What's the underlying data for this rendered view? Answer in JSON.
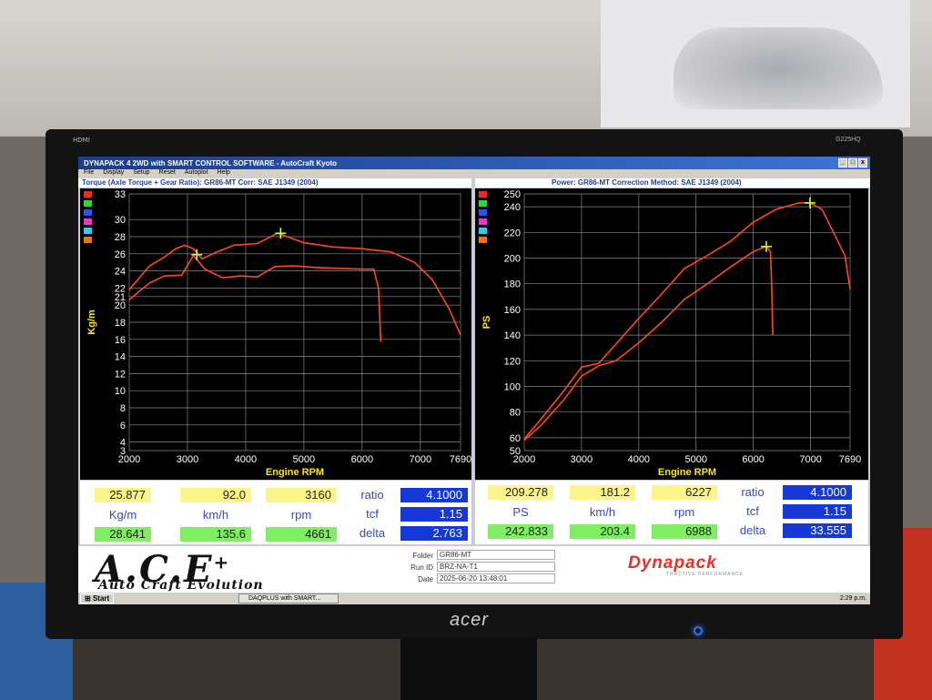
{
  "monitor": {
    "input_label": "HDMI",
    "model": "G225HQ",
    "brand": "acer"
  },
  "window": {
    "title": "DYNAPACK 4 2WD with SMART CONTROL SOFTWARE - AutoCraft Kyoto",
    "buttons": [
      "_",
      "□",
      "x"
    ],
    "menu": [
      "File",
      "Display",
      "Setup",
      "Reset",
      "Autoplot",
      "Help"
    ]
  },
  "headers": {
    "left": "Torque (Axle Torque + Gear Ratio): GR86-MT      Corr: SAE J1349 (2004)",
    "right": "Power: GR86-MT        Correction Method: SAE J1349 (2004)"
  },
  "colors": {
    "curve": "#ff4a1a",
    "marker": "#c8ff30",
    "grid": "#8a8a8a",
    "axis_label": "#ffe600",
    "legend": [
      "#e0302a",
      "#3ad23a",
      "#2a54e0",
      "#e040c0",
      "#36c8e8",
      "#e8742a"
    ]
  },
  "chart_data": [
    {
      "type": "line",
      "xlabel": "Engine RPM",
      "ylabel": "Kg/m",
      "xlim": [
        2000,
        7690
      ],
      "ylim": [
        3,
        33
      ],
      "x_ticks": [
        "2000",
        "3000",
        "4000",
        "5000",
        "6000",
        "7000",
        "7690"
      ],
      "y_ticks": [
        "3",
        "4",
        "6",
        "8",
        "10",
        "12",
        "14",
        "16",
        "18",
        "20",
        "21",
        "22",
        "24",
        "26",
        "28",
        "30",
        "33"
      ],
      "series": [
        {
          "x": [
            2000,
            2150,
            2350,
            2600,
            2800,
            2950,
            3100,
            3250,
            3500,
            3800,
            4200,
            4550,
            4750,
            5000,
            5500,
            6000,
            6500,
            6900,
            7200,
            7500,
            7690
          ],
          "y": [
            21.8,
            23.0,
            24.6,
            25.6,
            26.6,
            27.0,
            26.6,
            25.4,
            26.2,
            27.0,
            27.2,
            28.4,
            27.9,
            27.3,
            26.8,
            26.6,
            26.2,
            25.0,
            23.0,
            19.5,
            16.5
          ]
        },
        {
          "x": [
            2000,
            2150,
            2350,
            2600,
            2900,
            3100,
            3300,
            3600,
            3900,
            4200,
            4500,
            4800,
            5200,
            5600,
            6000,
            6200,
            6280,
            6300,
            6320
          ],
          "y": [
            20.6,
            21.5,
            22.6,
            23.4,
            23.5,
            25.8,
            24.2,
            23.2,
            23.4,
            23.3,
            24.5,
            24.6,
            24.4,
            24.3,
            24.2,
            24.2,
            22.0,
            19.0,
            15.7
          ]
        }
      ],
      "markers": [
        {
          "x": 4600,
          "y": 28.4
        },
        {
          "x": 3160,
          "y": 25.9
        }
      ]
    },
    {
      "type": "line",
      "xlabel": "Engine RPM",
      "ylabel": "PS",
      "xlim": [
        2000,
        7690
      ],
      "ylim": [
        50,
        250
      ],
      "x_ticks": [
        "2000",
        "3000",
        "4000",
        "5000",
        "6000",
        "7000",
        "7690"
      ],
      "y_ticks": [
        "50",
        "60",
        "80",
        "100",
        "120",
        "140",
        "160",
        "180",
        "200",
        "220",
        "240",
        "250"
      ],
      "series": [
        {
          "x": [
            2000,
            2300,
            2700,
            3000,
            3300,
            3600,
            4000,
            4400,
            4800,
            5200,
            5600,
            6000,
            6400,
            6800,
            6990,
            7200,
            7400,
            7600,
            7690
          ],
          "y": [
            59,
            75,
            97,
            115,
            118,
            133,
            153,
            172,
            192,
            202,
            213,
            228,
            238,
            243,
            243,
            238,
            220,
            202,
            176
          ]
        },
        {
          "x": [
            2000,
            2300,
            2700,
            3000,
            3300,
            3600,
            4000,
            4400,
            4800,
            5200,
            5600,
            6000,
            6227,
            6300,
            6320,
            6340
          ],
          "y": [
            58,
            70,
            90,
            108,
            116,
            120,
            134,
            150,
            168,
            180,
            193,
            205,
            209,
            205,
            180,
            140
          ]
        }
      ],
      "markers": [
        {
          "x": 6990,
          "y": 243
        },
        {
          "x": 6227,
          "y": 209
        }
      ]
    }
  ],
  "left_panel": {
    "row1": [
      "25.877",
      "92.0",
      "3160"
    ],
    "units": [
      "Kg/m",
      "km/h",
      "rpm"
    ],
    "row2": [
      "28.641",
      "135.6",
      "4661"
    ],
    "params": [
      {
        "label": "ratio",
        "value": "4.1000"
      },
      {
        "label": "tcf",
        "value": "1.15"
      },
      {
        "label": "delta",
        "value": "2.763"
      }
    ]
  },
  "right_panel": {
    "row1": [
      "209.278",
      "181.2",
      "6227"
    ],
    "units": [
      "PS",
      "km/h",
      "rpm"
    ],
    "row2": [
      "242.833",
      "203.4",
      "6988"
    ],
    "params": [
      {
        "label": "ratio",
        "value": "4.1000"
      },
      {
        "label": "tcf",
        "value": "1.15"
      },
      {
        "label": "delta",
        "value": "33.555"
      }
    ]
  },
  "footer": {
    "logo": "A.C.E",
    "logo_sup": "+",
    "logo_sub": "Auto Craft Evolution",
    "meta": [
      {
        "label": "Folder",
        "value": "GR86-MT"
      },
      {
        "label": "Run ID",
        "value": "BRZ-NA-T1"
      },
      {
        "label": "Date",
        "value": "2025-06-20 13:48:01"
      }
    ],
    "brand": "Dynapack",
    "brand_sub": "TRACTIVE PERFORMANCE"
  },
  "taskbar": {
    "start": "Start",
    "task": "DAQPLUS with SMART...",
    "clock": "2:29 p.m."
  }
}
